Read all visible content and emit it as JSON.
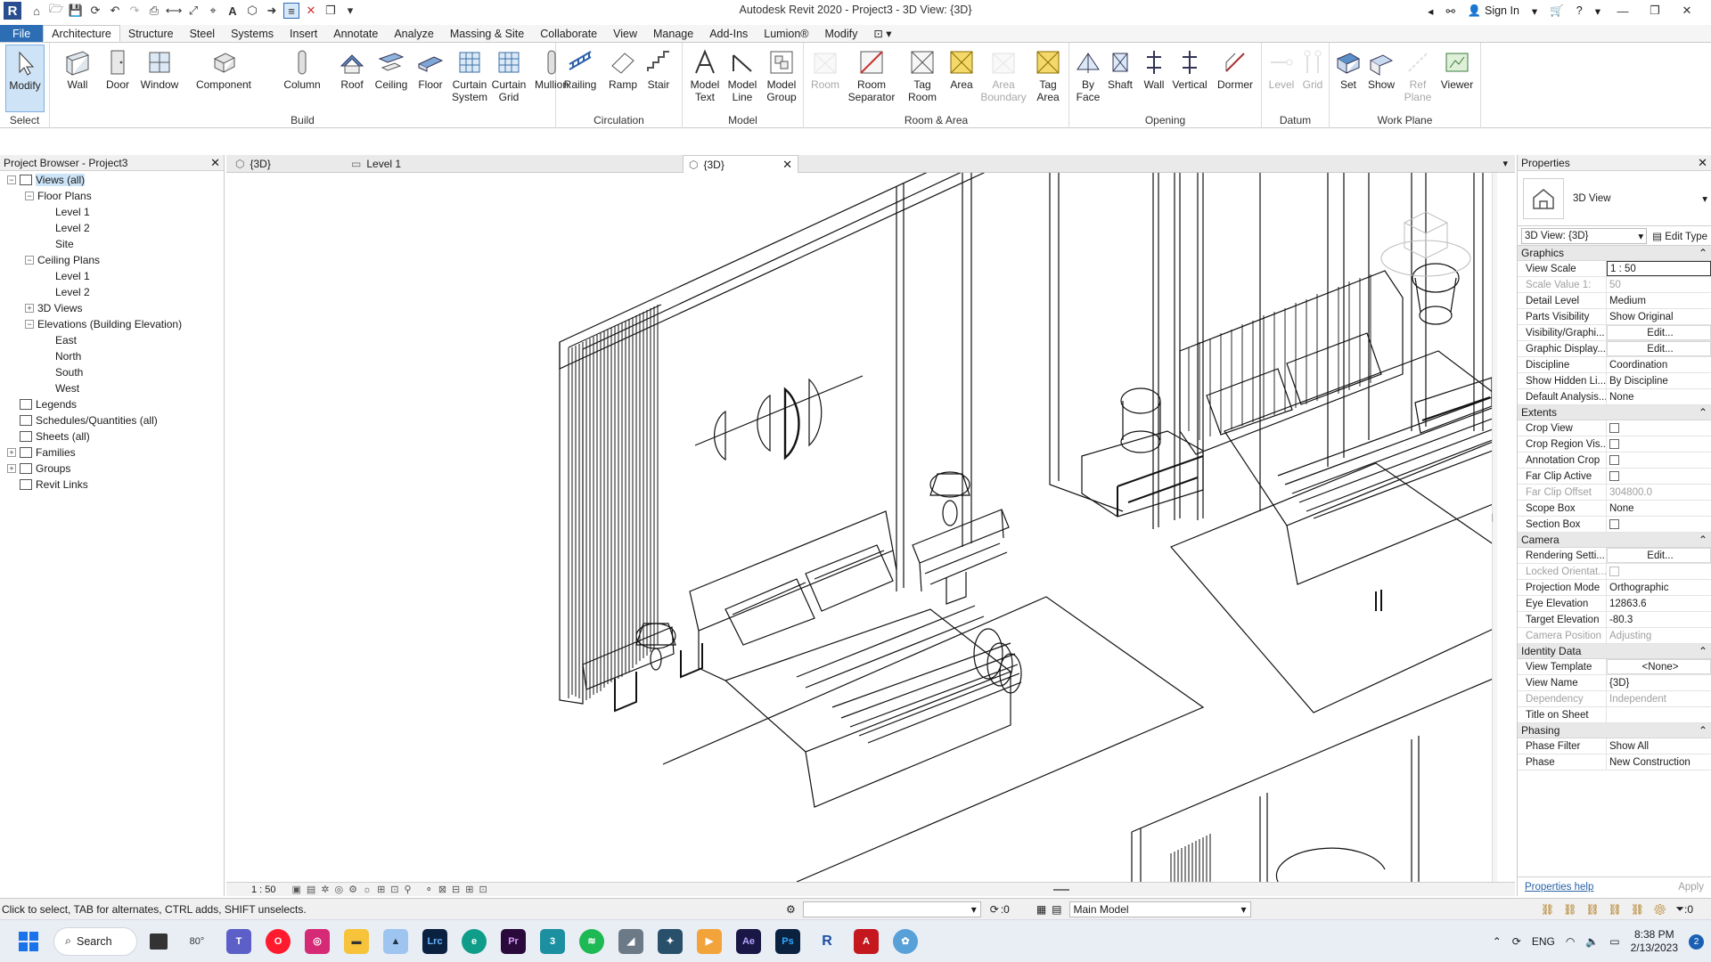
{
  "window": {
    "title": "Autodesk Revit 2020 - Project3 - 3D View: {3D}",
    "sign_in": "Sign In"
  },
  "ribbon_tabs": [
    "File",
    "Architecture",
    "Structure",
    "Steel",
    "Systems",
    "Insert",
    "Annotate",
    "Analyze",
    "Massing & Site",
    "Collaborate",
    "View",
    "Manage",
    "Add-Ins",
    "Lumion®",
    "Modify"
  ],
  "ribbon": {
    "select": {
      "label": "Select",
      "modify": "Modify"
    },
    "build": {
      "label": "Build",
      "buttons": [
        "Wall",
        "Door",
        "Window",
        "Component",
        "Column",
        "Roof",
        "Ceiling",
        "Floor",
        "Curtain\nSystem",
        "Curtain\nGrid",
        "Mullion"
      ]
    },
    "circulation": {
      "label": "Circulation",
      "buttons": [
        "Railing",
        "Ramp",
        "Stair"
      ]
    },
    "model": {
      "label": "Model",
      "buttons": [
        "Model\nText",
        "Model\nLine",
        "Model\nGroup"
      ]
    },
    "room_area": {
      "label": "Room & Area",
      "buttons": [
        "Room",
        "Room\nSeparator",
        "Tag\nRoom",
        "Area",
        "Area\nBoundary",
        "Tag\nArea"
      ]
    },
    "opening": {
      "label": "Opening",
      "buttons": [
        "By\nFace",
        "Shaft",
        "Wall",
        "Vertical",
        "Dormer"
      ]
    },
    "datum": {
      "label": "Datum",
      "buttons": [
        "Level",
        "Grid"
      ]
    },
    "work_plane": {
      "label": "Work Plane",
      "buttons": [
        "Set",
        "Show",
        "Ref\nPlane",
        "Viewer"
      ]
    }
  },
  "project_browser": {
    "title": "Project Browser - Project3",
    "tree": [
      {
        "label": "Views (all)",
        "depth": 0,
        "toggle": "−",
        "icon": "views-icon",
        "selected": true
      },
      {
        "label": "Floor Plans",
        "depth": 1,
        "toggle": "−"
      },
      {
        "label": "Level 1",
        "depth": 2
      },
      {
        "label": "Level 2",
        "depth": 2
      },
      {
        "label": "Site",
        "depth": 2
      },
      {
        "label": "Ceiling Plans",
        "depth": 1,
        "toggle": "−"
      },
      {
        "label": "Level 1",
        "depth": 2
      },
      {
        "label": "Level 2",
        "depth": 2
      },
      {
        "label": "3D Views",
        "depth": 1,
        "toggle": "+"
      },
      {
        "label": "Elevations (Building Elevation)",
        "depth": 1,
        "toggle": "−"
      },
      {
        "label": "East",
        "depth": 2
      },
      {
        "label": "North",
        "depth": 2
      },
      {
        "label": "South",
        "depth": 2
      },
      {
        "label": "West",
        "depth": 2
      },
      {
        "label": "Legends",
        "depth": 0,
        "icon": "legends-icon"
      },
      {
        "label": "Schedules/Quantities (all)",
        "depth": 0,
        "icon": "schedules-icon"
      },
      {
        "label": "Sheets (all)",
        "depth": 0,
        "icon": "sheets-icon"
      },
      {
        "label": "Families",
        "depth": 0,
        "toggle": "+",
        "icon": "families-icon"
      },
      {
        "label": "Groups",
        "depth": 0,
        "toggle": "+",
        "icon": "groups-icon"
      },
      {
        "label": "Revit Links",
        "depth": 0,
        "icon": "revit-links-icon"
      }
    ]
  },
  "view_tabs": [
    {
      "label": "{3D}",
      "icon": "3d-view-icon"
    },
    {
      "label": "Level 1",
      "icon": "floor-plan-icon"
    },
    {
      "label": "{3D}",
      "icon": "3d-view-icon",
      "active": true
    }
  ],
  "view_control_bar": {
    "scale": "1 : 50"
  },
  "properties": {
    "title": "Properties",
    "type_name": "3D View",
    "instance_selector": "3D View: {3D}",
    "edit_type": "Edit Type",
    "categories": [
      {
        "name": "Graphics",
        "rows": [
          {
            "key": "View Scale",
            "value": "1 : 50",
            "style": "boxed"
          },
          {
            "key": "Scale Value    1:",
            "value": "50",
            "dim": true
          },
          {
            "key": "Detail Level",
            "value": "Medium"
          },
          {
            "key": "Parts Visibility",
            "value": "Show Original"
          },
          {
            "key": "Visibility/Graphi...",
            "value": "Edit...",
            "style": "btn"
          },
          {
            "key": "Graphic Display...",
            "value": "Edit...",
            "style": "btn"
          },
          {
            "key": "Discipline",
            "value": "Coordination"
          },
          {
            "key": "Show Hidden Li...",
            "value": "By Discipline"
          },
          {
            "key": "Default Analysis...",
            "value": "None"
          }
        ]
      },
      {
        "name": "Extents",
        "rows": [
          {
            "key": "Crop View",
            "value": "",
            "style": "check"
          },
          {
            "key": "Crop Region Vis...",
            "value": "",
            "style": "check"
          },
          {
            "key": "Annotation Crop",
            "value": "",
            "style": "check"
          },
          {
            "key": "Far Clip Active",
            "value": "",
            "style": "check"
          },
          {
            "key": "Far Clip Offset",
            "value": "304800.0",
            "dim": true
          },
          {
            "key": "Scope Box",
            "value": "None"
          },
          {
            "key": "Section Box",
            "value": "",
            "style": "check"
          }
        ]
      },
      {
        "name": "Camera",
        "rows": [
          {
            "key": "Rendering Setti...",
            "value": "Edit...",
            "style": "btn"
          },
          {
            "key": "Locked Orientat...",
            "value": "",
            "style": "check",
            "dim": true
          },
          {
            "key": "Projection Mode",
            "value": "Orthographic"
          },
          {
            "key": "Eye Elevation",
            "value": "12863.6"
          },
          {
            "key": "Target Elevation",
            "value": "-80.3"
          },
          {
            "key": "Camera Position",
            "value": "Adjusting",
            "dim": true
          }
        ]
      },
      {
        "name": "Identity Data",
        "rows": [
          {
            "key": "View Template",
            "value": "<None>",
            "style": "btn"
          },
          {
            "key": "View Name",
            "value": "{3D}"
          },
          {
            "key": "Dependency",
            "value": "Independent",
            "dim": true
          },
          {
            "key": "Title on Sheet",
            "value": ""
          }
        ]
      },
      {
        "name": "Phasing",
        "rows": [
          {
            "key": "Phase Filter",
            "value": "Show All"
          },
          {
            "key": "Phase",
            "value": "New Construction"
          }
        ]
      }
    ],
    "help_link": "Properties help",
    "apply": "Apply"
  },
  "status_bar": {
    "message": "Click to select, TAB for alternates, CTRL adds, SHIFT unselects.",
    "workset_count": ":0",
    "model": "Main Model",
    "filter_count": ":0"
  },
  "taskbar": {
    "search": "Search",
    "weather": "80°",
    "language": "ENG",
    "time": "8:38 PM",
    "date": "2/13/2023",
    "notification_count": "2"
  }
}
